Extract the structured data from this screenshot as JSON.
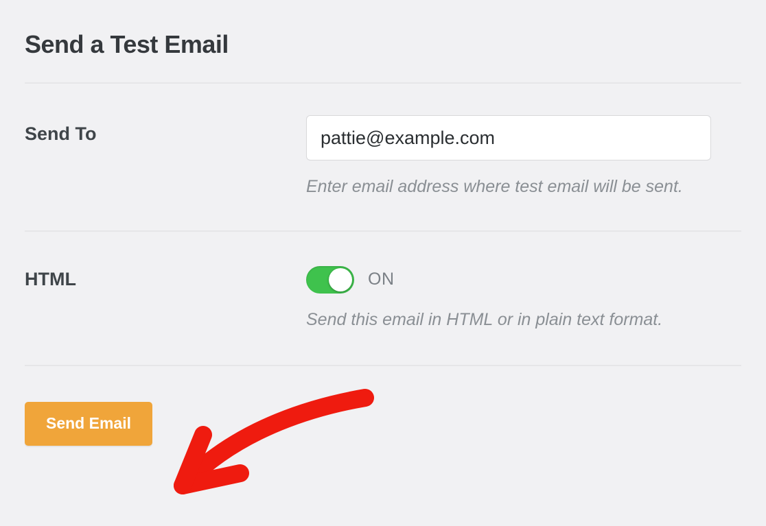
{
  "title": "Send a Test Email",
  "sendTo": {
    "label": "Send To",
    "value": "pattie@example.com",
    "hint": "Enter email address where test email will be sent."
  },
  "html": {
    "label": "HTML",
    "stateText": "ON",
    "hint": "Send this email in HTML or in plain text format."
  },
  "button": {
    "label": "Send Email"
  }
}
